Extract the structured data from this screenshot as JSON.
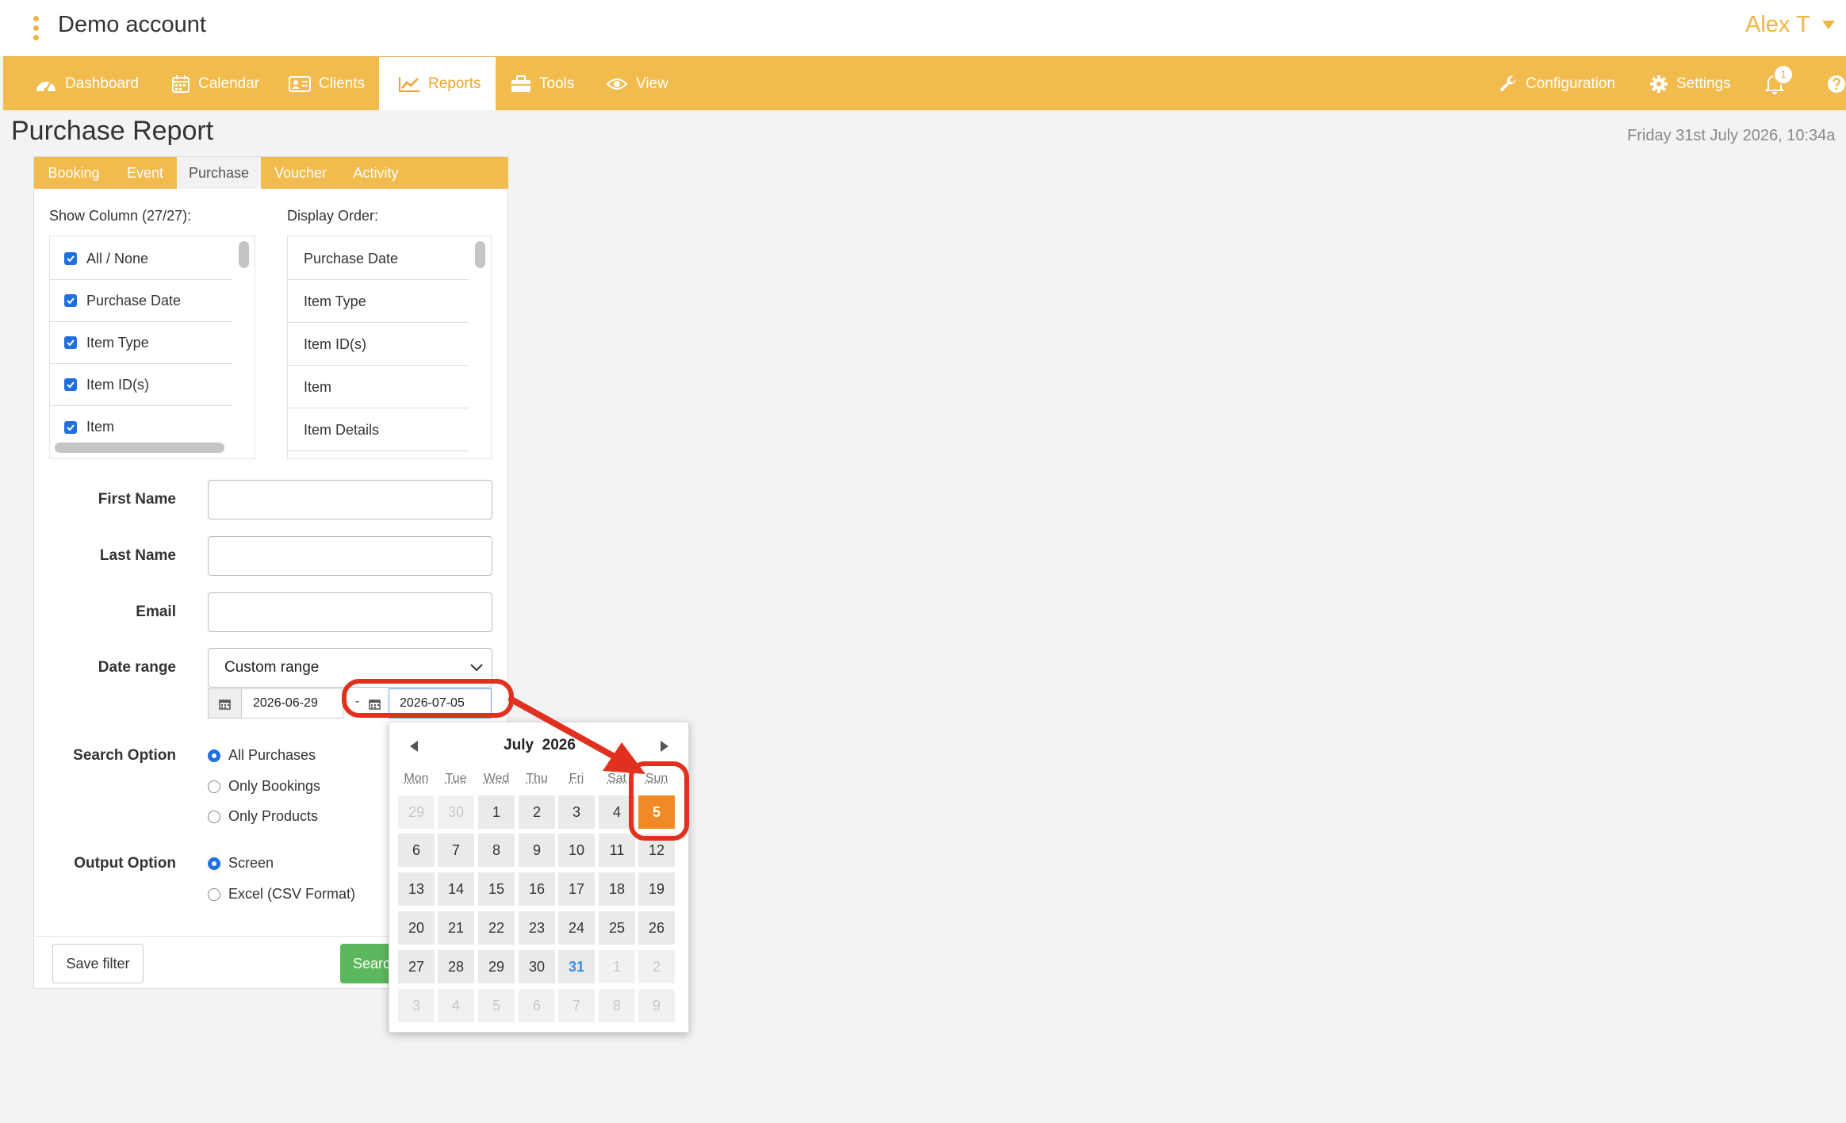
{
  "app": {
    "account_name": "Demo account",
    "user_name": "Alex T"
  },
  "nav": {
    "items": [
      {
        "label": "Dashboard",
        "icon": "dashboard-icon"
      },
      {
        "label": "Calendar",
        "icon": "calendar-icon"
      },
      {
        "label": "Clients",
        "icon": "clients-icon"
      },
      {
        "label": "Reports",
        "icon": "reports-icon",
        "active": true
      },
      {
        "label": "Tools",
        "icon": "toolbox-icon"
      },
      {
        "label": "View",
        "icon": "eye-icon"
      }
    ],
    "right": [
      {
        "label": "Configuration",
        "icon": "wrench-icon"
      },
      {
        "label": "Settings",
        "icon": "gear-icon"
      }
    ],
    "notification_count": "1"
  },
  "page": {
    "title": "Purchase Report",
    "datetime": "Friday 31st July 2026, 10:34a"
  },
  "report_tabs": [
    "Booking",
    "Event",
    "Purchase",
    "Voucher",
    "Activity"
  ],
  "active_tab": "Purchase",
  "columns": {
    "show_label": "Show Column (27/27):",
    "order_label": "Display Order:",
    "show_items": [
      "All / None",
      "Purchase Date",
      "Item Type",
      "Item ID(s)",
      "Item"
    ],
    "order_items": [
      "Purchase Date",
      "Item Type",
      "Item ID(s)",
      "Item",
      "Item Details"
    ]
  },
  "form": {
    "first_name_label": "First Name",
    "last_name_label": "Last Name",
    "email_label": "Email",
    "date_range_label": "Date range",
    "date_range_value": "Custom range",
    "date_from": "2026-06-29",
    "date_separator": "-",
    "date_to": "2026-07-05",
    "search_option_label": "Search Option",
    "search_options": [
      "All Purchases",
      "Only Bookings",
      "Only Products"
    ],
    "output_option_label": "Output Option",
    "output_options": [
      "Screen",
      "Excel (CSV Format)"
    ],
    "save_filter": "Save filter",
    "search_button": "Searc"
  },
  "calendar": {
    "month": "July",
    "year": "2026",
    "weekdays": [
      "Mon",
      "Tue",
      "Wed",
      "Thu",
      "Fri",
      "Sat",
      "Sun"
    ],
    "weeks": [
      [
        "29",
        "30",
        "1",
        "2",
        "3",
        "4",
        "5"
      ],
      [
        "6",
        "7",
        "8",
        "9",
        "10",
        "11",
        "12"
      ],
      [
        "13",
        "14",
        "15",
        "16",
        "17",
        "18",
        "19"
      ],
      [
        "20",
        "21",
        "22",
        "23",
        "24",
        "25",
        "26"
      ],
      [
        "27",
        "28",
        "29",
        "30",
        "31",
        "1",
        "2"
      ],
      [
        "3",
        "4",
        "5",
        "6",
        "7",
        "8",
        "9"
      ]
    ],
    "selected": "5",
    "today": "31"
  },
  "colors": {
    "brand": "#f2bb4e",
    "accent_orange": "#ef8a26",
    "annotation_red": "#e0311f",
    "checkbox_blue": "#1f6fe0",
    "search_green": "#5cb85c"
  }
}
